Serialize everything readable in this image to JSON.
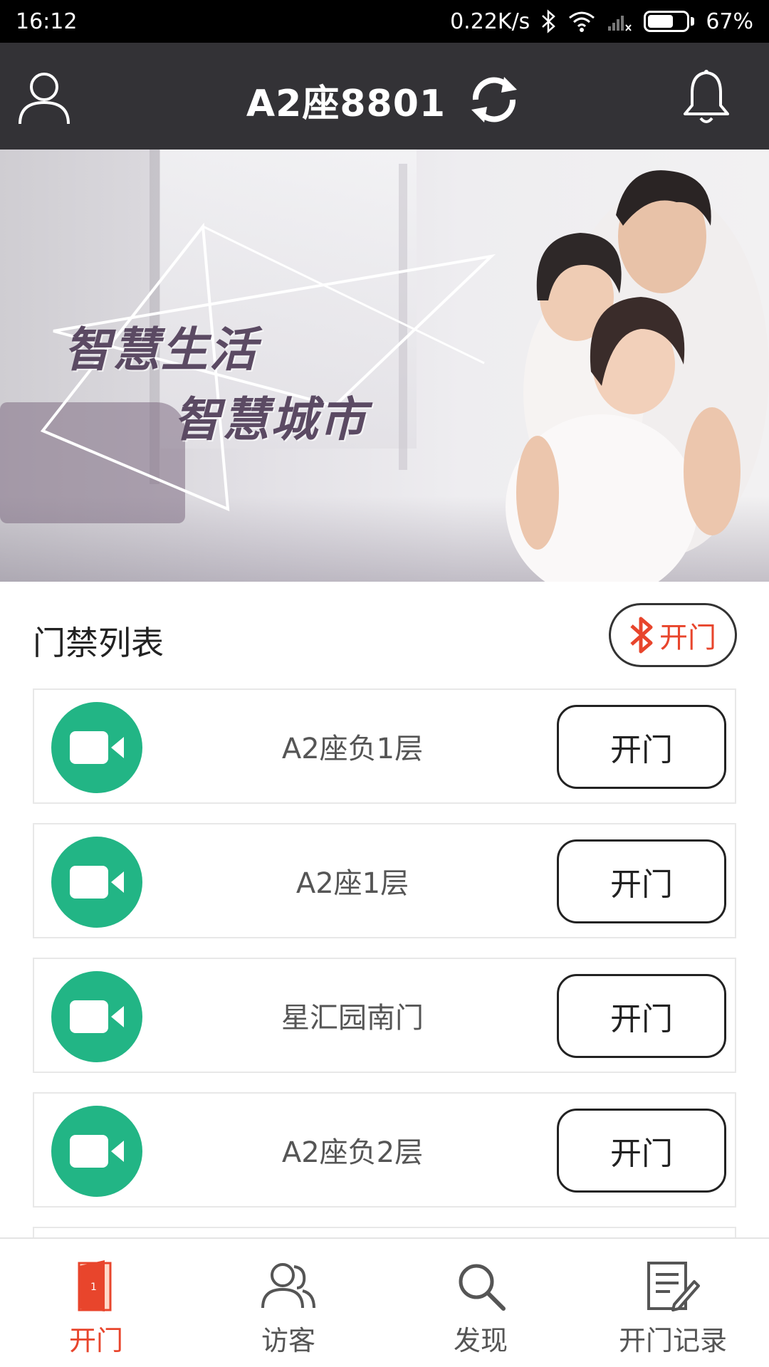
{
  "status_bar": {
    "time": "16:12",
    "network_speed": "0.22K/s",
    "battery": "67%",
    "battery_level": 0.67
  },
  "header": {
    "title": "A2座8801"
  },
  "banner": {
    "line1": "智慧生活",
    "line2": "智慧城市"
  },
  "section": {
    "title": "门禁列表",
    "bluetooth_open_label": "开门"
  },
  "doors": [
    {
      "name": "A2座负1层",
      "button": "开门"
    },
    {
      "name": "A2座1层",
      "button": "开门"
    },
    {
      "name": "星汇园南门",
      "button": "开门"
    },
    {
      "name": "A2座负2层",
      "button": "开门"
    }
  ],
  "bottom_nav": [
    {
      "label": "开门",
      "icon": "door-icon",
      "active": true
    },
    {
      "label": "访客",
      "icon": "visitors-icon",
      "active": false
    },
    {
      "label": "发现",
      "icon": "search-icon",
      "active": false
    },
    {
      "label": "开门记录",
      "icon": "records-icon",
      "active": false
    }
  ],
  "colors": {
    "accent": "#e8452c",
    "camera_green": "#22b585",
    "header_bg": "#333236"
  }
}
